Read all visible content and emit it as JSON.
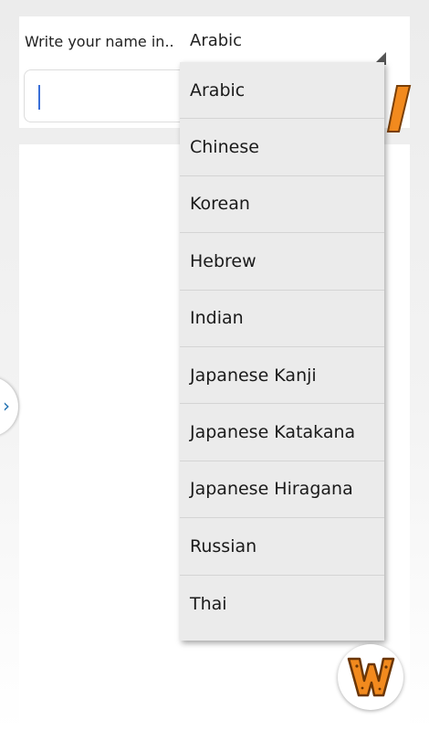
{
  "header": {
    "prompt_label": "Write your name in..",
    "selected_language": "Arabic"
  },
  "name_input": {
    "value": ""
  },
  "language_dropdown": {
    "options": [
      "Arabic",
      "Chinese",
      "Korean",
      "Hebrew",
      "Indian",
      "Japanese Kanji",
      "Japanese Katakana",
      "Japanese Hiragana",
      "Russian",
      "Thai"
    ]
  },
  "side_tab": {
    "icon": "chevron-right-icon",
    "glyph": "›"
  },
  "fab": {
    "icon": "w-logo-icon"
  },
  "colors": {
    "accent_orange": "#f28a1e",
    "chevron_blue": "#1e6fb0",
    "cursor_blue": "#3a6fd8"
  }
}
